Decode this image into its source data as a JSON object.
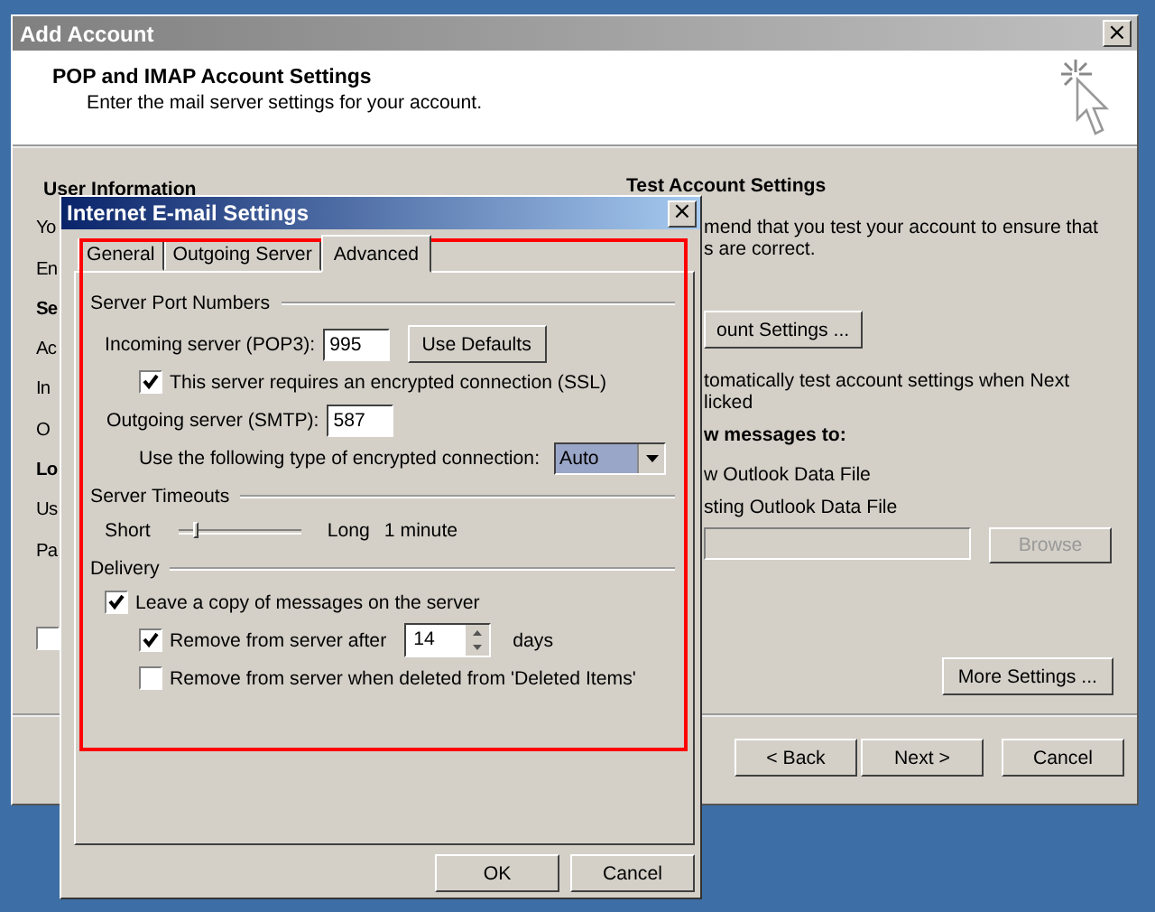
{
  "add_account": {
    "title": "Add Account",
    "header": {
      "title": "POP and IMAP Account Settings",
      "subtitle": "Enter the mail server settings for your account."
    },
    "left_fragments": [
      {
        "text": "User Information",
        "kind": "heading"
      },
      {
        "text": "Yo",
        "kind": "label"
      },
      {
        "text": "En",
        "kind": "label"
      },
      {
        "text": "Se",
        "kind": "heading"
      },
      {
        "text": "Ac",
        "kind": "label"
      },
      {
        "text": "In",
        "kind": "label"
      },
      {
        "text": "O",
        "kind": "label"
      },
      {
        "text": "Lo",
        "kind": "heading"
      },
      {
        "text": "Us",
        "kind": "label"
      },
      {
        "text": "Pa",
        "kind": "label"
      }
    ],
    "left_checkbox": {
      "checked": false
    },
    "test_heading": "Test Account Settings",
    "test_text": [
      "mend that you test your account to ensure that",
      "s are correct."
    ],
    "test_button": "ount Settings ...",
    "auto_test_text": [
      "tomatically test account settings when Next",
      "licked"
    ],
    "deliver_heading": "w messages to:",
    "deliver_options": [
      "w Outlook Data File",
      "sting Outlook Data File"
    ],
    "browse_button": {
      "label": "Browse",
      "disabled": true
    },
    "more_settings_button": "More Settings ...",
    "buttons": [
      "< Back",
      "Next >",
      "Cancel"
    ]
  },
  "dialog": {
    "title": "Internet E-mail Settings",
    "close": "×",
    "tabs": [
      {
        "label": "General",
        "selected": false
      },
      {
        "label": "Outgoing Server",
        "selected": false
      },
      {
        "label": "Advanced",
        "selected": true
      }
    ],
    "port_group": "Server Port Numbers",
    "incoming": {
      "label": "Incoming server (POP3):",
      "value": "995"
    },
    "use_defaults": "Use Defaults",
    "ssl": {
      "label": "This server requires an encrypted connection (SSL)",
      "checked": true
    },
    "outgoing": {
      "label": "Outgoing server (SMTP):",
      "value": "587"
    },
    "encryption": {
      "label": "Use the following type of encrypted connection:",
      "value": "Auto"
    },
    "timeout_group": "Server Timeouts",
    "timeout": {
      "min_label": "Short",
      "max_label": "Long",
      "level": 0.12,
      "reading": "1 minute"
    },
    "delivery_group": "Delivery",
    "leave_copy": {
      "label": "Leave a copy of messages on the server",
      "checked": true
    },
    "remove_after": {
      "label": "Remove from server after",
      "checked": true,
      "value": "14",
      "unit": "days"
    },
    "remove_deleted": {
      "label": "Remove from server when deleted from 'Deleted Items'",
      "checked": false
    },
    "buttons": [
      "OK",
      "Cancel"
    ]
  }
}
